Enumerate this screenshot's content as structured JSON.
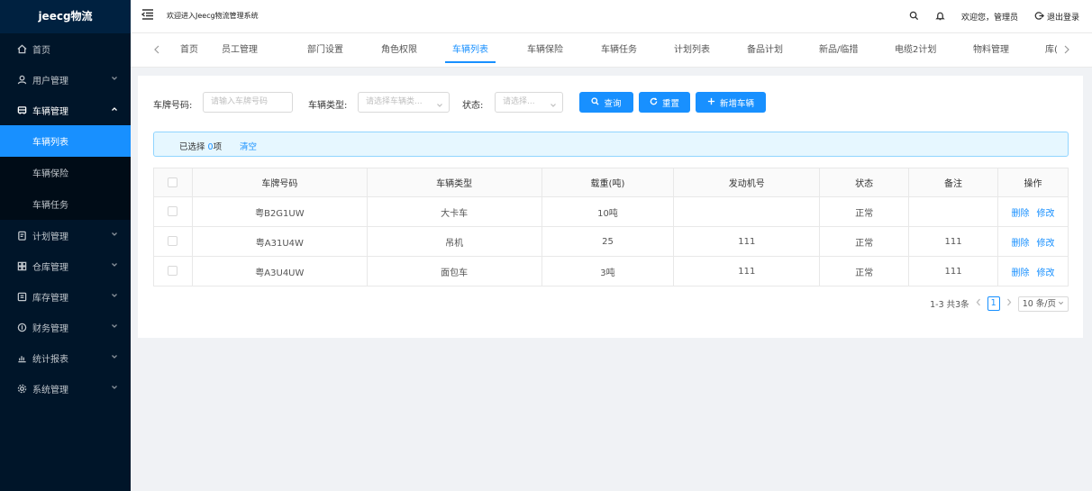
{
  "app": {
    "logo": "jeecg物流"
  },
  "header": {
    "welcome": "欢迎进入Jeecg物流管理系统",
    "greeting": "欢迎您，管理员",
    "logout": "退出登录"
  },
  "sidebar": {
    "items": [
      {
        "label": "首页",
        "icon": "home-icon"
      },
      {
        "label": "用户管理",
        "icon": "user-icon"
      },
      {
        "label": "车辆管理",
        "icon": "car-icon"
      },
      {
        "label": "计划管理",
        "icon": "plan-icon"
      },
      {
        "label": "仓库管理",
        "icon": "warehouse-icon"
      },
      {
        "label": "库存管理",
        "icon": "stock-icon"
      },
      {
        "label": "财务管理",
        "icon": "finance-icon"
      },
      {
        "label": "统计报表",
        "icon": "chart-icon"
      },
      {
        "label": "系统管理",
        "icon": "settings-icon"
      }
    ],
    "vehicle_sub": [
      "车辆列表",
      "车辆保险",
      "车辆任务"
    ],
    "active_sub": "车辆列表"
  },
  "tabs": [
    "首页",
    "员工管理",
    "部门设置",
    "角色权限",
    "车辆列表",
    "车辆保险",
    "车辆任务",
    "计划列表",
    "备品计划",
    "新品/临措",
    "电缆2计划",
    "物料管理",
    "库("
  ],
  "active_tab": "车辆列表",
  "search": {
    "plate_label": "车牌号码:",
    "plate_placeholder": "请输入车牌号码",
    "type_label": "车辆类型:",
    "type_placeholder": "请选择车辆类...",
    "status_label": "状态:",
    "status_placeholder": "请选择...",
    "query_btn": "查询",
    "reset_btn": "重置",
    "add_btn": "新增车辆"
  },
  "alert": {
    "prefix": "已选择 ",
    "count": "0",
    "suffix": "项",
    "clear": "清空"
  },
  "table": {
    "columns": [
      "车牌号码",
      "车辆类型",
      "载重(吨)",
      "发动机号",
      "状态",
      "备注",
      "操作"
    ],
    "rows": [
      {
        "plate": "粤B2G1UW",
        "type": "大卡车",
        "load": "10吨",
        "engine": "",
        "status": "正常",
        "note": ""
      },
      {
        "plate": "粤A31U4W",
        "type": "吊机",
        "load": "25",
        "engine": "111",
        "status": "正常",
        "note": "111"
      },
      {
        "plate": "粤A3U4UW",
        "type": "面包车",
        "load": "3吨",
        "engine": "111",
        "status": "正常",
        "note": "111"
      }
    ],
    "delete_label": "删除",
    "edit_label": "修改"
  },
  "pagination": {
    "summary": "1-3 共3条",
    "current": "1",
    "page_size": "10 条/页"
  },
  "colors": {
    "primary": "#1890ff",
    "sidebar_bg": "#001529",
    "submenu_bg": "#000c17"
  }
}
